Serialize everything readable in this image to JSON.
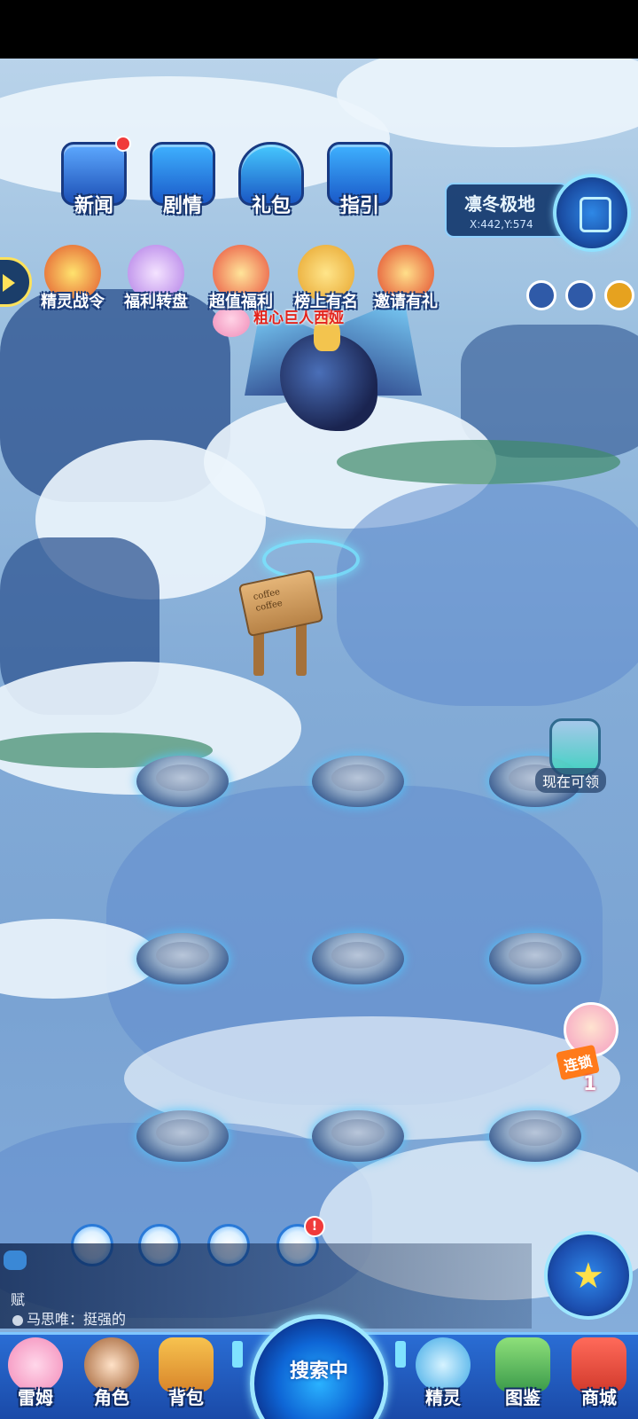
{
  "top_menu": [
    {
      "id": "news",
      "label": "新闻",
      "icon": "newspaper-tv-icon",
      "has_badge": true
    },
    {
      "id": "story",
      "label": "剧情",
      "icon": "story-server-icon",
      "has_badge": false
    },
    {
      "id": "gift",
      "label": "礼包",
      "icon": "gift-pack-icon",
      "has_badge": false
    },
    {
      "id": "guide",
      "label": "指引",
      "icon": "guide-server-icon",
      "has_badge": false
    }
  ],
  "activities": [
    {
      "id": "battle-pass",
      "label": "精灵战令",
      "icon": "battle-pass-icon"
    },
    {
      "id": "lucky-wheel",
      "label": "福利转盘",
      "icon": "lucky-wheel-icon"
    },
    {
      "id": "value-deal",
      "label": "超值福利",
      "icon": "gift-box-icon"
    },
    {
      "id": "leaderboard",
      "label": "榜上有名",
      "icon": "trophy-icon"
    },
    {
      "id": "invite",
      "label": "邀请有礼",
      "icon": "invite-envelope-icon"
    }
  ],
  "location": {
    "name": "凛冬极地",
    "coords": "X:442,Y:574"
  },
  "player": {
    "name": "粗心巨人西娅"
  },
  "sign_text": [
    "coffee",
    "coffee"
  ],
  "bottle": {
    "label": "现在可领"
  },
  "combo": {
    "tag": "连锁",
    "count": "1"
  },
  "chat": {
    "line1": "赋",
    "line2": "马思唯：挺强的"
  },
  "bottom_nav": [
    {
      "id": "leimu",
      "label": "雷姆",
      "icon": "pink-pet-icon"
    },
    {
      "id": "role",
      "label": "角色",
      "icon": "character-icon"
    },
    {
      "id": "bag",
      "label": "背包",
      "icon": "backpack-icon"
    },
    {
      "id": "sprite",
      "label": "精灵",
      "icon": "sprite-icon"
    },
    {
      "id": "codex",
      "label": "图鉴",
      "icon": "codex-book-icon"
    },
    {
      "id": "shop",
      "label": "商城",
      "icon": "shop-icon"
    }
  ],
  "search": {
    "label": "搜索中"
  },
  "colors": {
    "accent": "#1c4fb5",
    "glow": "#9ee7ff",
    "player_name": "#e3241c",
    "badge": "#f03a3a"
  }
}
